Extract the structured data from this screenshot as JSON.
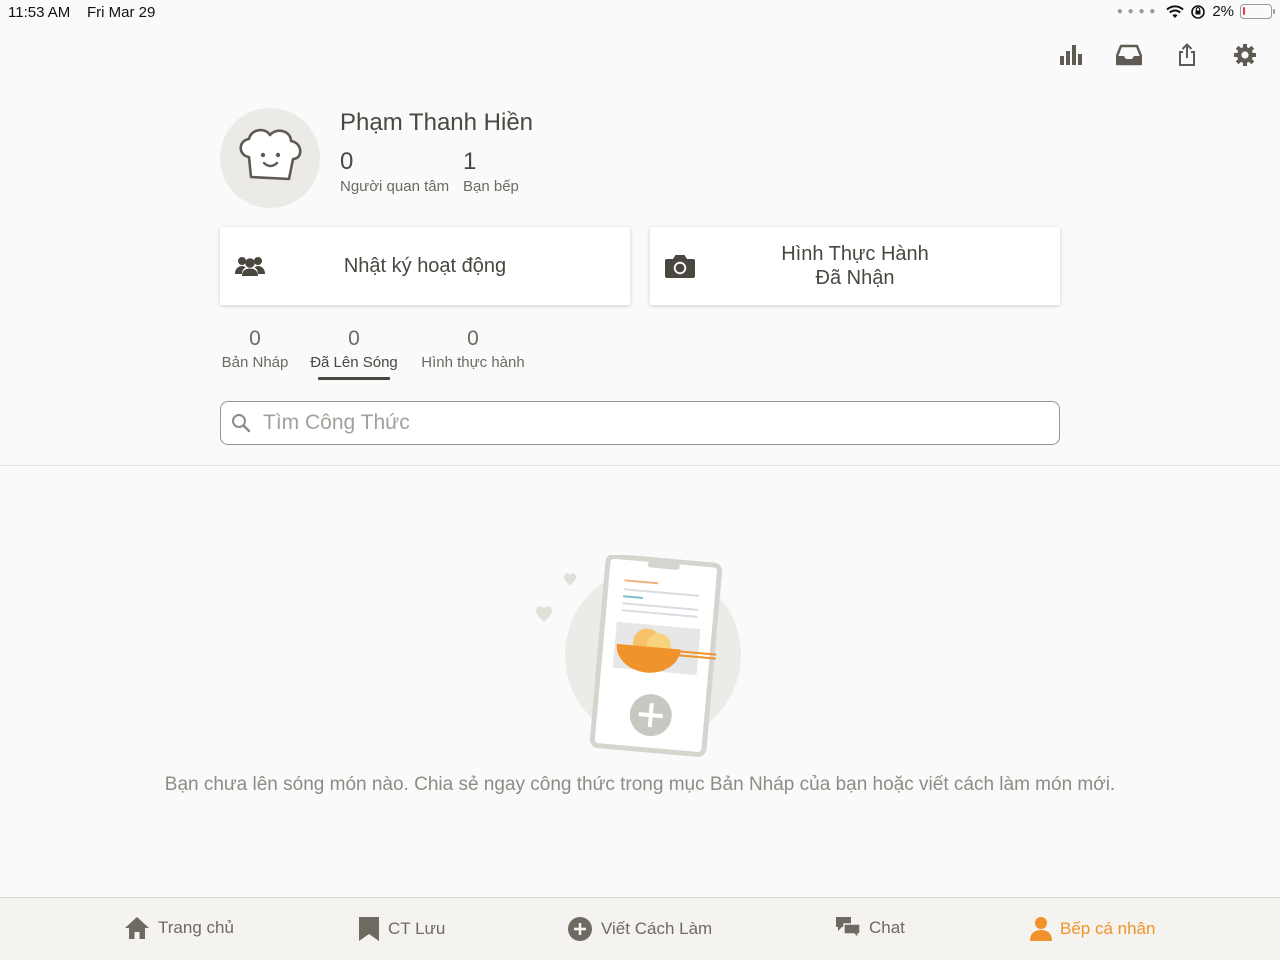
{
  "status_bar": {
    "time": "11:53 AM",
    "date": "Fri Mar 29",
    "battery": "2%"
  },
  "toolbar": {
    "icons": [
      "stats-icon",
      "inbox-icon",
      "share-icon",
      "settings-icon"
    ]
  },
  "profile": {
    "name": "Phạm Thanh Hiền",
    "followers_count": "0",
    "followers_label": "Người quan tâm",
    "friends_count": "1",
    "friends_label": "Bạn bếp"
  },
  "cards": {
    "activity_label": "Nhật ký hoạt động",
    "cooksnaps_line1": "Hình Thực Hành",
    "cooksnaps_line2": "Đã Nhận"
  },
  "tabs": [
    {
      "count": "0",
      "label": "Bản Nháp"
    },
    {
      "count": "0",
      "label": "Đã Lên Sóng"
    },
    {
      "count": "0",
      "label": "Hình thực hành"
    }
  ],
  "search": {
    "placeholder": "Tìm Công Thức",
    "value": ""
  },
  "empty_state": {
    "message": "Bạn chưa lên sóng món nào. Chia sẻ ngay công thức trong mục Bản Nháp của bạn hoặc viết cách làm món mới."
  },
  "bottom_nav": [
    {
      "label": "Trang chủ",
      "icon": "home-icon"
    },
    {
      "label": "CT Lưu",
      "icon": "bookmark-icon"
    },
    {
      "label": "Viết Cách Làm",
      "icon": "plus-circle-icon"
    },
    {
      "label": "Chat",
      "icon": "chat-icon"
    },
    {
      "label": "Bếp cá nhân",
      "icon": "person-icon",
      "active": true
    }
  ],
  "colors": {
    "accent": "#f0932b",
    "text": "#4a4640",
    "muted": "#6e6a62",
    "background": "#fafafa"
  }
}
